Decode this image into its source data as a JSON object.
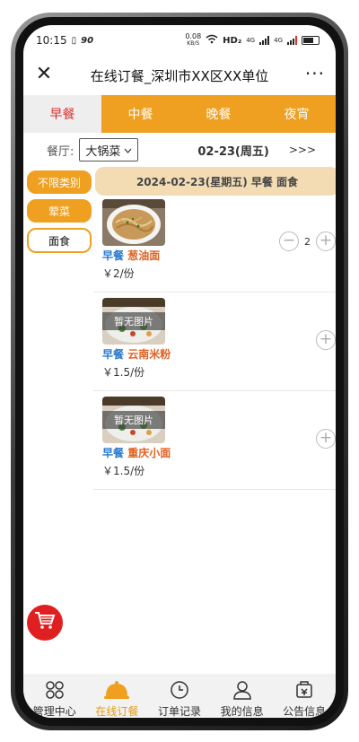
{
  "status": {
    "time": "10:15",
    "speed_left": "90",
    "speed_right_top": "0.08",
    "speed_right_bottom": "KB/S",
    "hd": "HD₂",
    "net1": "4G",
    "net2": "4G"
  },
  "header": {
    "title": "在线订餐_深圳市XX区XX单位",
    "more": "···"
  },
  "meal_tabs": [
    {
      "label": "早餐",
      "active": true
    },
    {
      "label": "中餐",
      "active": false
    },
    {
      "label": "晚餐",
      "active": false
    },
    {
      "label": "夜宵",
      "active": false
    }
  ],
  "restaurant": {
    "label": "餐厅:",
    "selected": "大锅菜",
    "date": "02-23(周五)",
    "next": ">>>"
  },
  "categories": [
    {
      "label": "不限类别",
      "active": false
    },
    {
      "label": "荤菜",
      "active": false
    },
    {
      "label": "面食",
      "active": true
    }
  ],
  "day_header": "2024-02-23(星期五) 早餐 面食",
  "dishes": [
    {
      "meal": "早餐",
      "name": "葱油面",
      "price": "￥2/份",
      "quantity": "2",
      "has_image": true,
      "no_image_label": ""
    },
    {
      "meal": "早餐",
      "name": "云南米粉",
      "price": "￥1.5/份",
      "quantity": "",
      "has_image": false,
      "no_image_label": "暂无图片"
    },
    {
      "meal": "早餐",
      "name": "重庆小面",
      "price": "￥1.5/份",
      "quantity": "",
      "has_image": false,
      "no_image_label": "暂无图片"
    }
  ],
  "bottom_nav": [
    {
      "label": "管理中心",
      "icon": "grid-icon",
      "active": false
    },
    {
      "label": "在线订餐",
      "icon": "dome-icon",
      "active": true
    },
    {
      "label": "订单记录",
      "icon": "clock-icon",
      "active": false
    },
    {
      "label": "我的信息",
      "icon": "user-icon",
      "active": false
    },
    {
      "label": "公告信息",
      "icon": "notice-icon",
      "active": false
    }
  ],
  "colors": {
    "accent": "#f0a020",
    "active_tab_text": "#e03030",
    "meal_label": "#2a7ad0",
    "dish_name": "#e06020",
    "cart": "#e02020",
    "day_header_bg": "#f3dcb4"
  }
}
